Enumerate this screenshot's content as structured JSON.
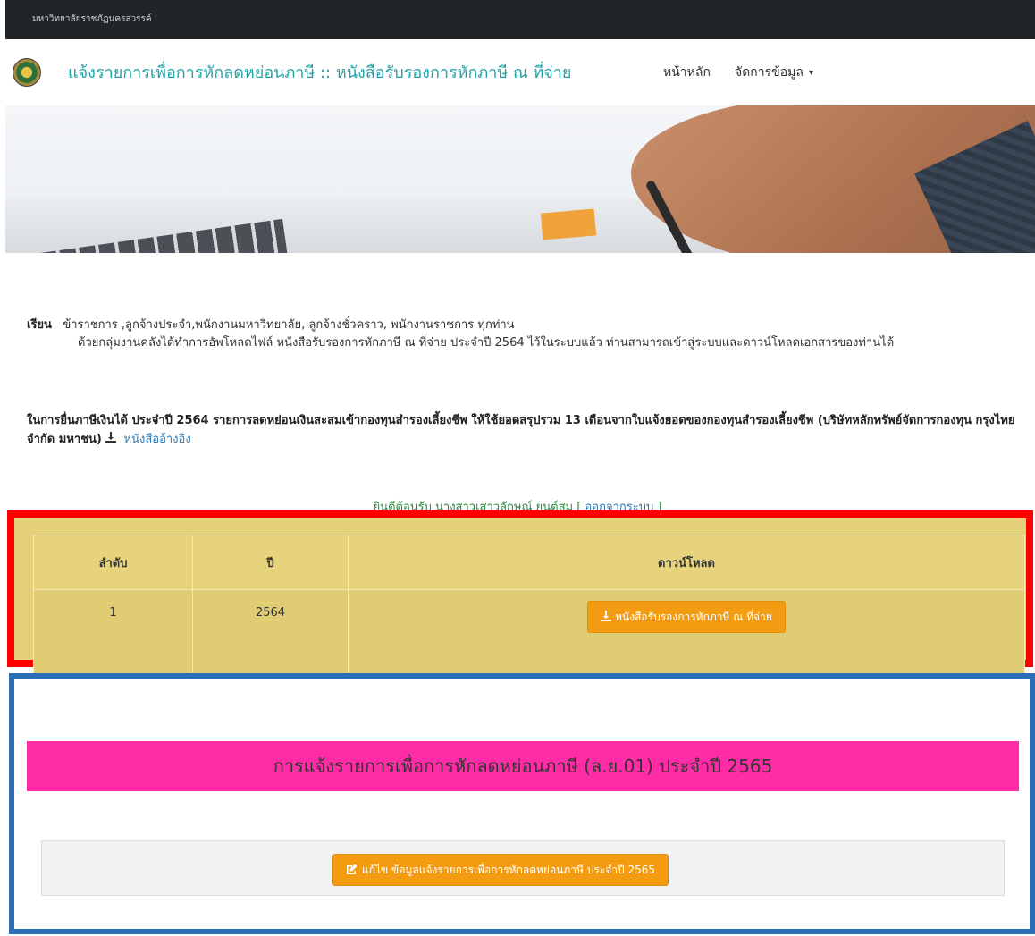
{
  "topbar": {
    "university_name": "มหาวิทยาลัยราชภัฏนครสวรรค์"
  },
  "navbar": {
    "title": "แจ้งรายการเพื่อการหักลดหย่อนภาษี :: หนังสือรับรองการหักภาษี ณ ที่จ่าย",
    "home_label": "หน้าหลัก",
    "manage_label": "จัดการข้อมูล",
    "manage_caret": "▾"
  },
  "notice": {
    "lead": "เรียน",
    "addressees": "ข้าราชการ ,ลูกจ้างประจำ,พนักงานมหาวิทยาลัย, ลูกจ้างชั่วคราว, พนักงานราชการ ทุกท่าน",
    "body": "ด้วยกลุ่มงานคลังได้ทำการอัพโหลดไฟล์ หนังสือรับรองการหักภาษี ณ ที่จ่าย ประจำปี 2564 ไว้ในระบบแล้ว ท่านสามารถเข้าสู่ระบบและดาวน์โหลดเอกสารของท่านได้"
  },
  "tax_notice": {
    "text": "ในการยื่นภาษีเงินได้ ประจำปี 2564 รายการลดหย่อนเงินสะสมเข้ากองทุนสำรองเลี้ยงชีพ ให้ใช้ยอดสรุปรวม 13 เดือนจากใบแจ้งยอดของกองทุนสำรองเลี้ยงชีพ (บริษัทหลักทรัพย์จัดการกองทุน กรุงไทย จำกัด มหาชน)",
    "ref_link": "หนังสืออ้างอิง"
  },
  "welcome": {
    "text": "ยินดีต้อนรับ นางสาวเสาวลักษณ์ ยนต์สม",
    "logout_open": "[",
    "logout": "ออกจากระบบ",
    "logout_close": "]"
  },
  "download_table": {
    "headers": [
      "ลำดับ",
      "ปี",
      "ดาวน์โหลด"
    ],
    "rows": [
      {
        "no": "1",
        "year": "2564",
        "button": "หนังสือรับรองการหักภาษี ณ ที่จ่าย"
      }
    ]
  },
  "ly01_section": {
    "heading": "การแจ้งรายการเพื่อการหักลดหย่อนภาษี (ล.ย.01) ประจำปี 2565",
    "edit_button": "แก้ไข ข้อมูลแจ้งรายการเพื่อการหักลดหย่อนภาษี ประจำปี 2565"
  },
  "colors": {
    "brand_teal": "#1fa3a9",
    "highlight_red": "#ff0000",
    "highlight_blue": "#2a6eb8",
    "table_bg": "#e5d17a",
    "button_orange": "#f39c12",
    "heading_pink": "#ff2ba7"
  },
  "icons": {
    "download": "download-icon",
    "edit": "edit-icon",
    "logo": "university-seal"
  }
}
